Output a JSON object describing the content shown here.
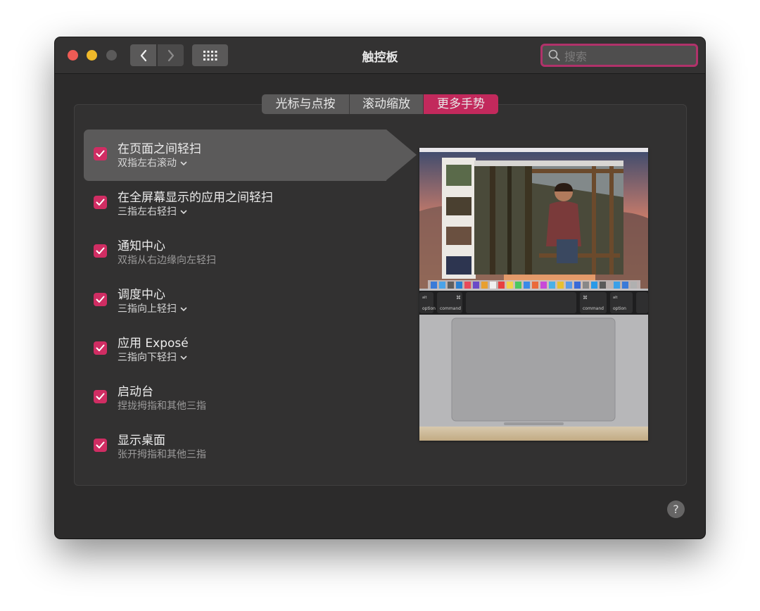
{
  "window": {
    "title": "触控板"
  },
  "search": {
    "placeholder": "搜索"
  },
  "tabs": [
    {
      "label": "光标与点按",
      "selected": false
    },
    {
      "label": "滚动缩放",
      "selected": false
    },
    {
      "label": "更多手势",
      "selected": true
    }
  ],
  "gestures": [
    {
      "title": "在页面之间轻扫",
      "subtitle": "双指左右滚动",
      "checked": true,
      "has_menu": true,
      "selected": true
    },
    {
      "title": "在全屏幕显示的应用之间轻扫",
      "subtitle": "三指左右轻扫",
      "checked": true,
      "has_menu": true
    },
    {
      "title": "通知中心",
      "subtitle": "双指从右边缘向左轻扫",
      "checked": true,
      "has_menu": false
    },
    {
      "title": "调度中心",
      "subtitle": "三指向上轻扫",
      "checked": true,
      "has_menu": true
    },
    {
      "title": "应用 Exposé",
      "subtitle": "三指向下轻扫",
      "checked": true,
      "has_menu": true
    },
    {
      "title": "启动台",
      "subtitle": "捏拢拇指和其他三指",
      "checked": true,
      "has_menu": false
    },
    {
      "title": "显示桌面",
      "subtitle": "张开拇指和其他三指",
      "checked": true,
      "has_menu": false
    }
  ],
  "preview": {
    "keys": {
      "alt": "alt",
      "command": "command",
      "option": "option"
    }
  },
  "help": {
    "label": "?"
  },
  "colors": {
    "accent": "#c2295c",
    "window_bg": "#2c2b2b",
    "search_focus": "#b1326a"
  }
}
